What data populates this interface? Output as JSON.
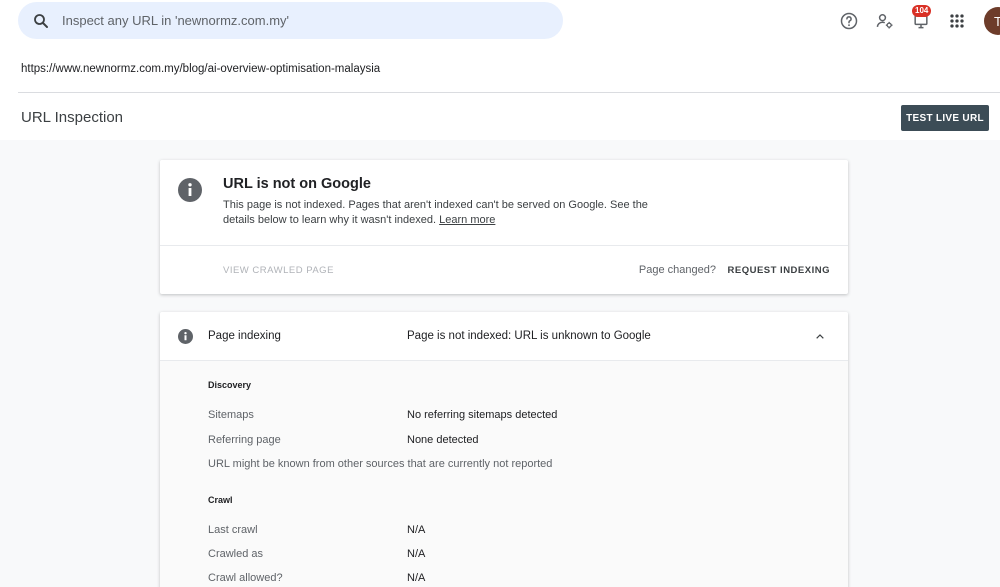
{
  "search": {
    "placeholder": "Inspect any URL in 'newnormz.com.my'"
  },
  "header": {
    "notifications_count": "104",
    "avatar_initial": "T"
  },
  "url": "https://www.newnormz.com.my/blog/ai-overview-optimisation-malaysia",
  "page_title": "URL Inspection",
  "test_live_label": "TEST LIVE URL",
  "status_card": {
    "title": "URL is not on Google",
    "description": "This page is not indexed. Pages that aren't indexed can't be served on Google. See the details below to learn why it wasn't indexed.",
    "learn_more": "Learn more",
    "view_crawled": "VIEW CRAWLED PAGE",
    "page_changed": "Page changed?",
    "request_indexing": "REQUEST INDEXING"
  },
  "indexing": {
    "label": "Page indexing",
    "status": "Page is not indexed: URL is unknown to Google",
    "discovery": {
      "heading": "Discovery",
      "rows": [
        {
          "label": "Sitemaps",
          "value": "No referring sitemaps detected"
        },
        {
          "label": "Referring page",
          "value": "None detected"
        }
      ],
      "note": "URL might be known from other sources that are currently not reported"
    },
    "crawl": {
      "heading": "Crawl",
      "rows": [
        {
          "label": "Last crawl",
          "value": "N/A"
        },
        {
          "label": "Crawled as",
          "value": "N/A"
        },
        {
          "label": "Crawl allowed?",
          "value": "N/A"
        }
      ]
    }
  },
  "colors": {
    "search_bg": "#e8f0fe",
    "button_bg": "#3c4c56",
    "badge": "#d93025",
    "avatar": "#6d3c2a"
  }
}
